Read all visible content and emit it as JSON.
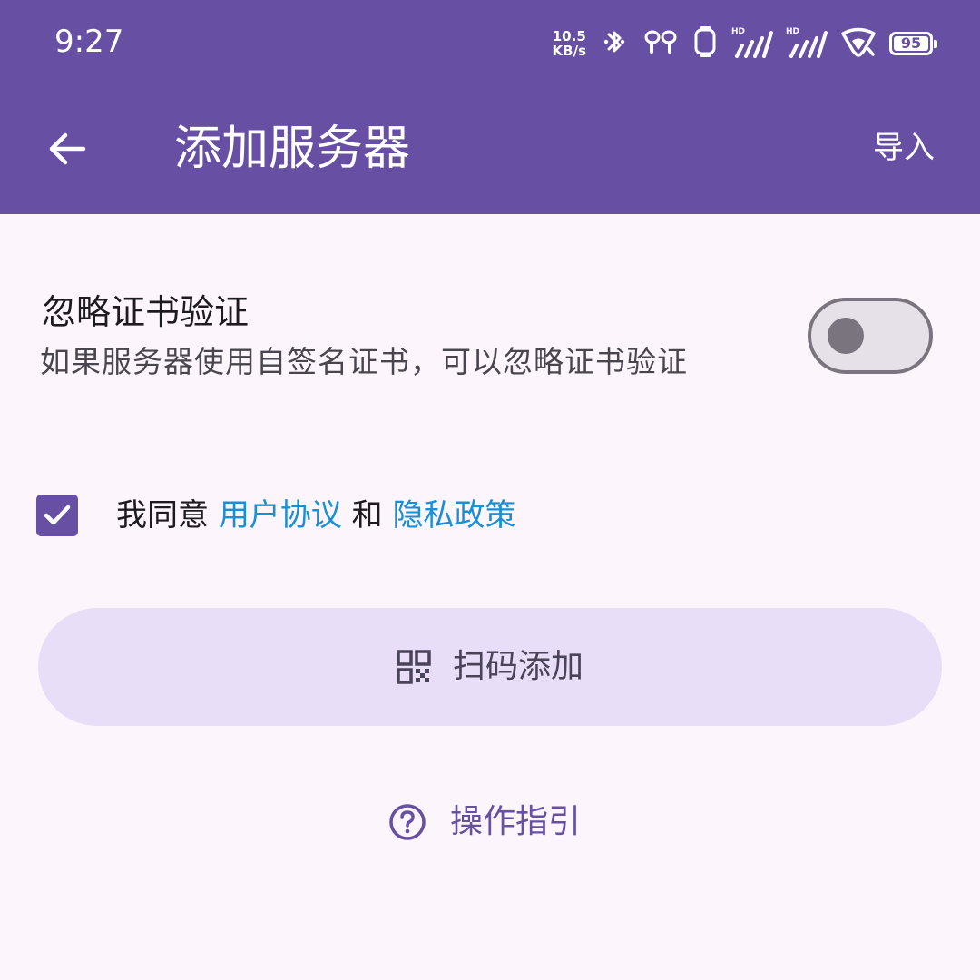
{
  "status_bar": {
    "time": "9:27",
    "net_speed_value": "10.5",
    "net_speed_unit": "KB/s",
    "battery_level": "95",
    "icons": [
      "bluetooth-icon",
      "earbuds-icon",
      "watch-icon",
      "signal-hd-1-icon",
      "signal-hd-2-icon",
      "wifi-icon",
      "battery-icon"
    ]
  },
  "app_bar": {
    "title": "添加服务器",
    "action_label": "导入",
    "back_icon": "arrow-back-icon"
  },
  "settings": {
    "ignore_cert_title": "忽略证书验证",
    "ignore_cert_desc": "如果服务器使用自签名证书，可以忽略证书验证",
    "ignore_cert_enabled": false
  },
  "agreement": {
    "checked": true,
    "prefix": "我同意 ",
    "user_agreement": "用户协议",
    "conjunction": " 和 ",
    "privacy_policy": "隐私政策"
  },
  "actions": {
    "scan_label": "扫码添加",
    "scan_icon": "qr-code-icon",
    "guide_label": "操作指引",
    "guide_icon": "help-circle-icon"
  },
  "colors": {
    "primary": "#6750A4",
    "background": "#FCF6FC",
    "tonal_button": "#E8DEF8",
    "link": "#1A8FD6"
  }
}
